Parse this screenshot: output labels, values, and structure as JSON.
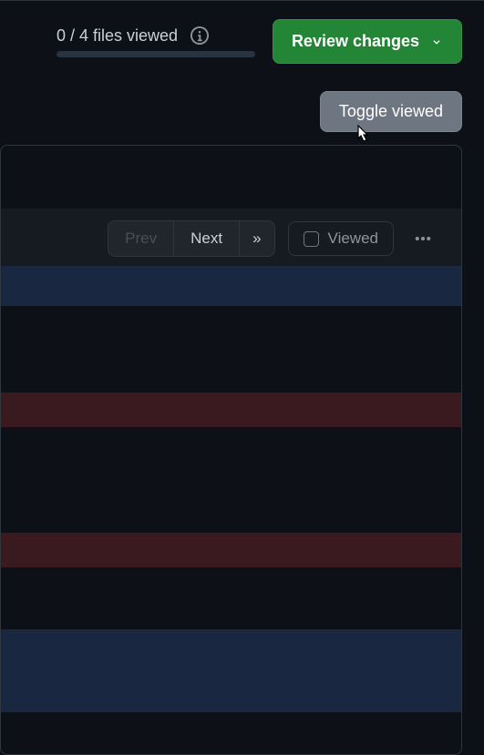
{
  "header": {
    "files_viewed_text": "0 / 4 files viewed",
    "review_button_label": "Review changes"
  },
  "tooltip": {
    "text": "Toggle viewed"
  },
  "toolbar": {
    "prev_label": "Prev",
    "next_label": "Next",
    "expand_label": "»",
    "viewed_label": "Viewed"
  },
  "diff_lines": [
    {
      "type": "hunk",
      "height_class": "line-h1"
    },
    {
      "type": "normal",
      "height_class": "line-h2"
    },
    {
      "type": "deletion",
      "height_class": "line-h3"
    },
    {
      "type": "normal",
      "height_class": "line-h4"
    },
    {
      "type": "deletion",
      "height_class": "line-h5"
    },
    {
      "type": "normal",
      "height_class": "line-h6"
    },
    {
      "type": "hunk",
      "height_class": "line-h7"
    }
  ]
}
